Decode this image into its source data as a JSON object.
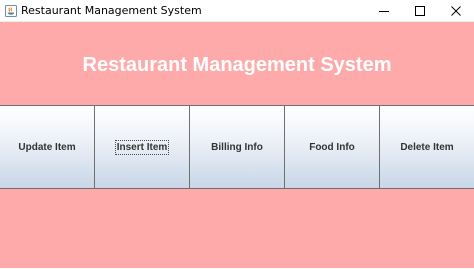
{
  "window": {
    "title": "Restaurant Management System",
    "icon": "java-app-icon",
    "controls": {
      "minimize_icon": "minimize-icon",
      "maximize_icon": "maximize-icon",
      "close_icon": "close-icon"
    }
  },
  "main": {
    "heading": "Restaurant Management System",
    "background_color": "#ffaaaa"
  },
  "buttons": [
    {
      "label": "Update Item"
    },
    {
      "label": "Insert Item",
      "focused": true
    },
    {
      "label": "Billing Info"
    },
    {
      "label": "Food Info"
    },
    {
      "label": "Delete Item"
    }
  ]
}
